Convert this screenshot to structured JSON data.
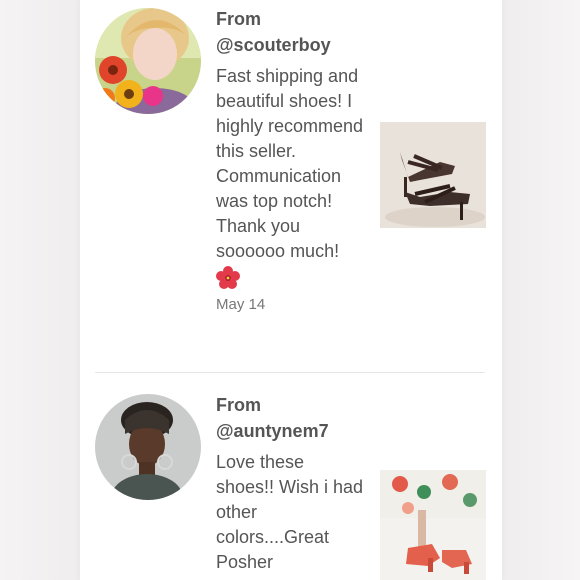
{
  "reviews": [
    {
      "from_label": "From",
      "username": "@scouterboy",
      "text": "Fast shipping and beautiful shoes! I highly recommend this seller. Communication was top notch! Thank you soooooo much!",
      "emoji_icon": "hibiscus-icon",
      "date": "May 14",
      "avatar": "avatar-woman-with-flowers",
      "thumbnail": "strappy-heel-sandals"
    },
    {
      "from_label": "From",
      "username": "@auntynem7",
      "text": "Love these shoes!! Wish i had other colors....Great Posher",
      "avatar": "avatar-woman-with-earrings",
      "thumbnail": "red-mary-jane-heels"
    }
  ]
}
